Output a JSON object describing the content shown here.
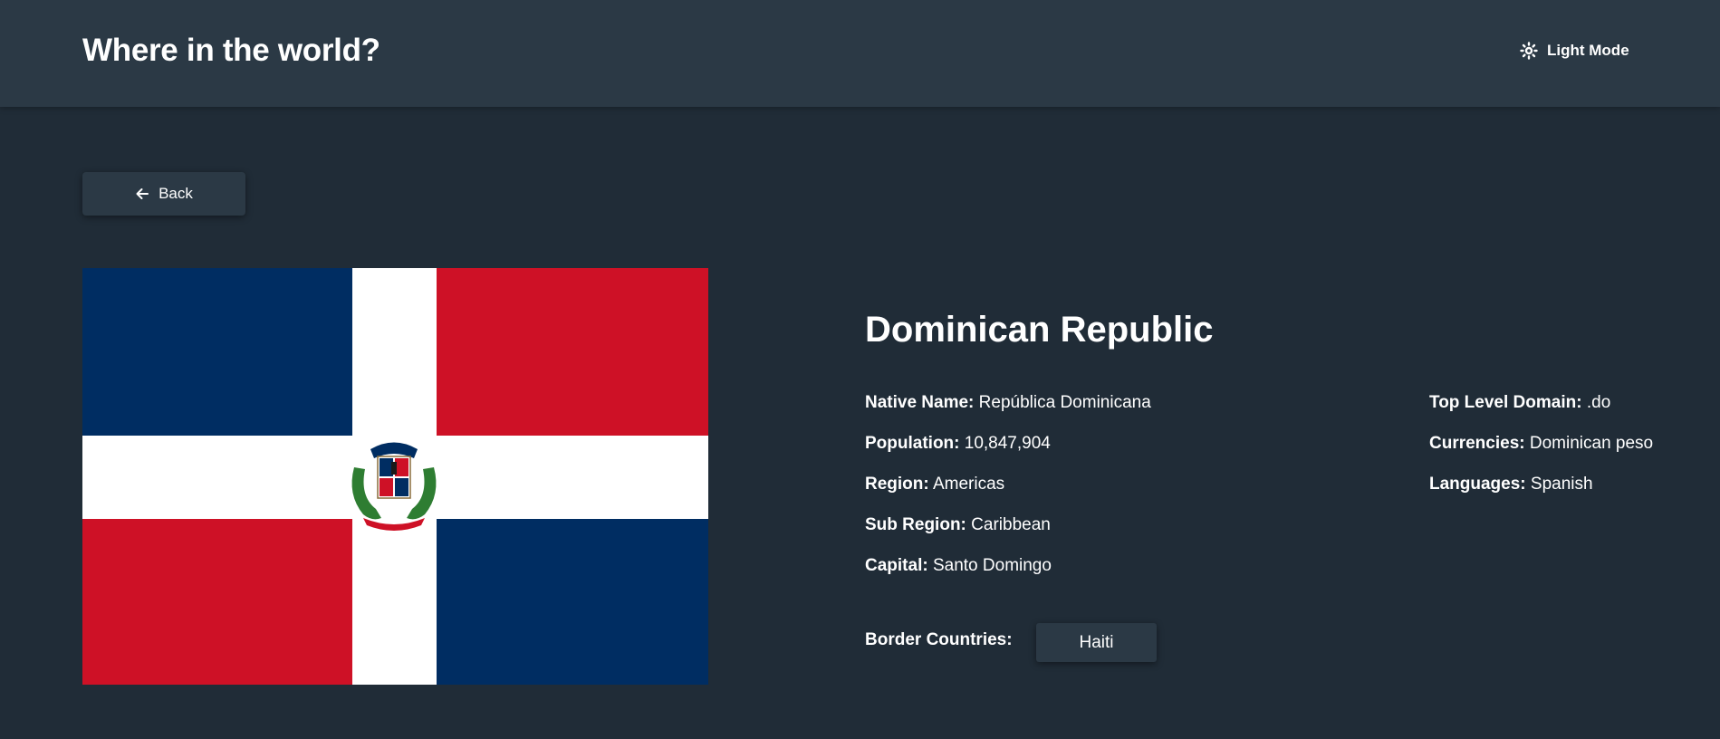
{
  "header": {
    "title": "Where in the world?",
    "theme_toggle_label": "Light Mode",
    "theme_icon": "sun-icon"
  },
  "back_button": {
    "label": "Back",
    "icon": "arrow-left-icon"
  },
  "country": {
    "name": "Dominican Republic",
    "flag_icon": "dominican-republic-flag",
    "flag_colors": {
      "blue": "#002d62",
      "red": "#ce1126",
      "white": "#ffffff"
    },
    "left_details": [
      {
        "label": "Native Name:",
        "value": "República Dominicana"
      },
      {
        "label": "Population:",
        "value": "10,847,904"
      },
      {
        "label": "Region:",
        "value": "Americas"
      },
      {
        "label": "Sub Region:",
        "value": "Caribbean"
      },
      {
        "label": "Capital:",
        "value": "Santo Domingo"
      }
    ],
    "right_details": [
      {
        "label": "Top Level Domain:",
        "value": ".do"
      },
      {
        "label": "Currencies:",
        "value": "Dominican peso"
      },
      {
        "label": "Languages:",
        "value": "Spanish"
      }
    ],
    "border_label": "Border Countries:",
    "borders": [
      "Haiti"
    ]
  },
  "colors": {
    "background": "#202c37",
    "elements": "#2b3945",
    "text": "#ffffff"
  }
}
